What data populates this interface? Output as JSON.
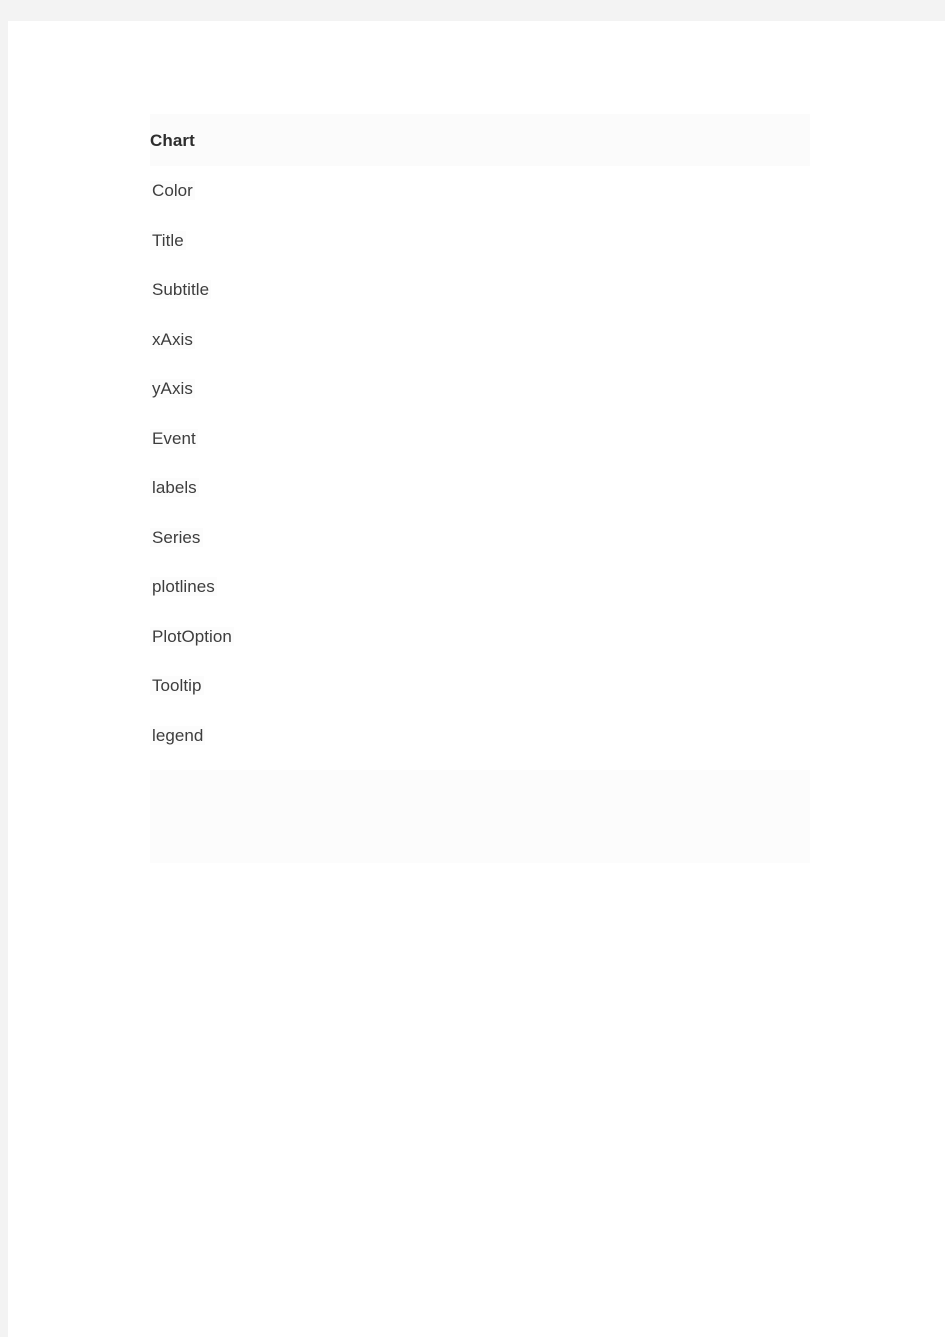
{
  "window": {
    "background_color": "#ffffff",
    "chrome_color": "#f3f3f3"
  },
  "outline": {
    "header": {
      "label": "Chart",
      "background_color": "#fbfbfb",
      "text_color": "#2d2d2d"
    },
    "item_text_color": "#3d3d3d",
    "item_highlight_color": "#fcfcfc",
    "items": [
      {
        "label": "Color"
      },
      {
        "label": "Title"
      },
      {
        "label": "Subtitle"
      },
      {
        "label": "xAxis"
      },
      {
        "label": "yAxis"
      },
      {
        "label": "Event"
      },
      {
        "label": "labels"
      },
      {
        "label": "Series"
      },
      {
        "label": "plotlines"
      },
      {
        "label": "PlotOption"
      },
      {
        "label": "Tooltip"
      },
      {
        "label": "legend"
      }
    ],
    "placeholder": {
      "label": "",
      "background_color": "#fcfcfc"
    }
  }
}
